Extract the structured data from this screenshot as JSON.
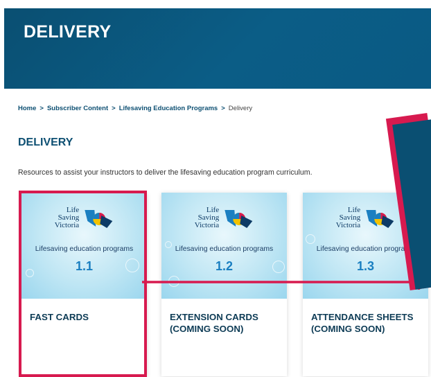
{
  "hero": {
    "title": "DELIVERY"
  },
  "breadcrumb": {
    "items": [
      "Home",
      "Subscriber Content",
      "Lifesaving Education Programs"
    ],
    "current": "Delivery"
  },
  "section": {
    "title": "DELIVERY",
    "description": "Resources to assist your instructors to deliver the lifesaving education program curriculum."
  },
  "logo_text": [
    "Life",
    "Saving",
    "Victoria"
  ],
  "cards": [
    {
      "program": "Lifesaving education programs",
      "version": "1.1",
      "title": "FAST CARDS"
    },
    {
      "program": "Lifesaving education programs",
      "version": "1.2",
      "title": "EXTENSION CARDS (COMING SOON)"
    },
    {
      "program": "Lifesaving education programs",
      "version": "1.3",
      "title": "ATTENDANCE SHEETS (COMING SOON)"
    }
  ],
  "colors": {
    "brand": "#0b5d86",
    "highlight": "#d71a4f",
    "accent": "#1a7fc1"
  }
}
